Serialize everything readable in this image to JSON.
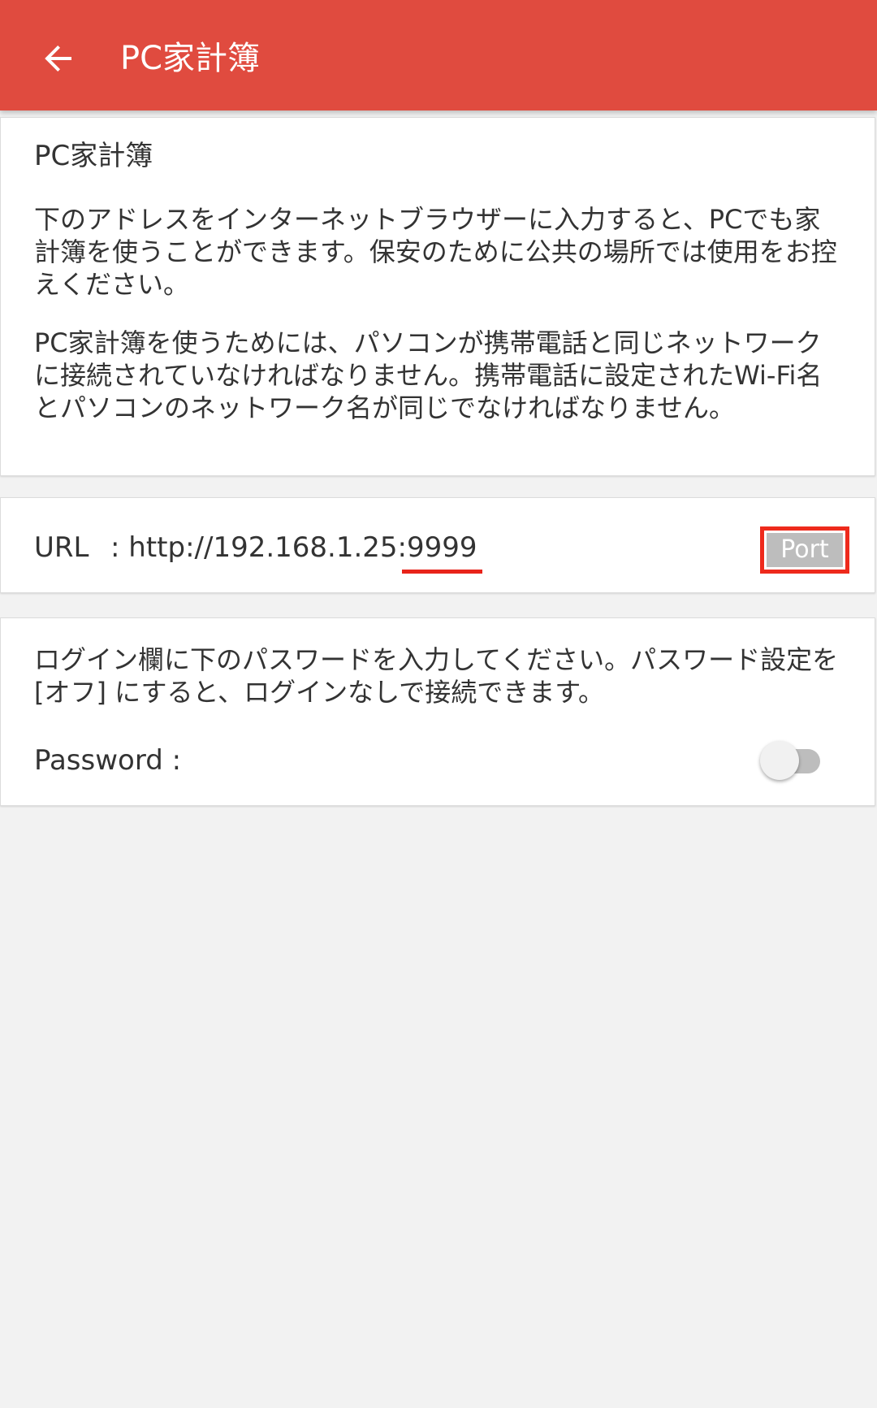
{
  "app_bar": {
    "title": "PC家計簿",
    "back_icon": "arrow-left-icon",
    "color": "#e04b3f"
  },
  "info_card": {
    "title": "PC家計簿",
    "paragraph_1": "下のアドレスをインターネットブラウザーに入力すると、PCでも家計簿を使うことができます。保安のために公共の場所では使用をお控えください。",
    "paragraph_2": "PC家計簿を使うためには、パソコンが携帯電話と同じネットワークに接続されていなければなりません。携帯電話に設定されたWi-Fi名とパソコンのネットワーク名が同じでなければなりません。"
  },
  "url_card": {
    "label": "URL",
    "separator": ":",
    "address_prefix": "http://192.168.1.25:",
    "port": "9999",
    "port_button_label": "Port",
    "highlight_color": "#ee2a1c"
  },
  "password_card": {
    "description": "ログイン欄に下のパスワードを入力してください。パスワード設定を [オフ] にすると、ログインなしで接続できます。",
    "label": "Password :",
    "toggle_on": false
  }
}
